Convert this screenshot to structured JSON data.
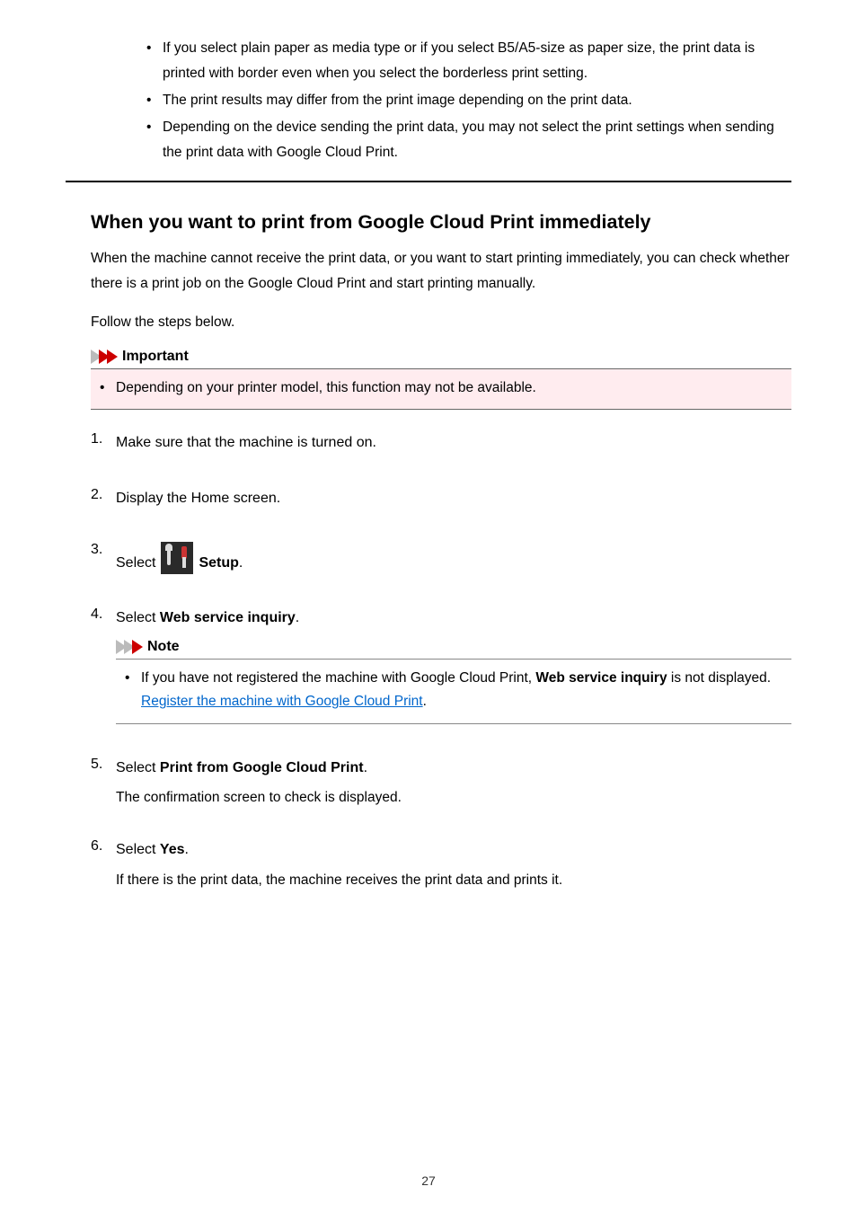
{
  "topBullets": [
    "If you select plain paper as media type or if you select B5/A5-size as paper size, the print data is printed with border even when you select the borderless print setting.",
    "The print results may differ from the print image depending on the print data.",
    "Depending on the device sending the print data, you may not select the print settings when sending the print data with Google Cloud Print."
  ],
  "heading": "When you want to print from Google Cloud Print immediately",
  "introParagraphs": [
    "When the machine cannot receive the print data, or you want to start printing immediately, you can check whether there is a print job on the Google Cloud Print and start printing manually.",
    "Follow the steps below."
  ],
  "important": {
    "title": "Important",
    "items": [
      "Depending on your printer model, this function may not be available."
    ]
  },
  "steps": {
    "s1": "Make sure that the machine is turned on.",
    "s2": "Display the Home screen.",
    "s3": {
      "prefix": "Select ",
      "bold": "Setup",
      "suffix": "."
    },
    "s4": {
      "prefix": "Select ",
      "bold": "Web service inquiry",
      "suffix": ".",
      "note": {
        "title": "Note",
        "text1": "If you have not registered the machine with Google Cloud Print, ",
        "bold1": "Web service inquiry",
        "text2": " is not displayed.",
        "linkText": "Register the machine with Google Cloud Print",
        "linkSuffix": "."
      }
    },
    "s5": {
      "prefix": "Select ",
      "bold": "Print from Google Cloud Print",
      "suffix": ".",
      "sub": "The confirmation screen to check is displayed."
    },
    "s6": {
      "prefix": "Select ",
      "bold": "Yes",
      "suffix": ".",
      "sub": "If there is the print data, the machine receives the print data and prints it."
    }
  },
  "pageNumber": "27"
}
